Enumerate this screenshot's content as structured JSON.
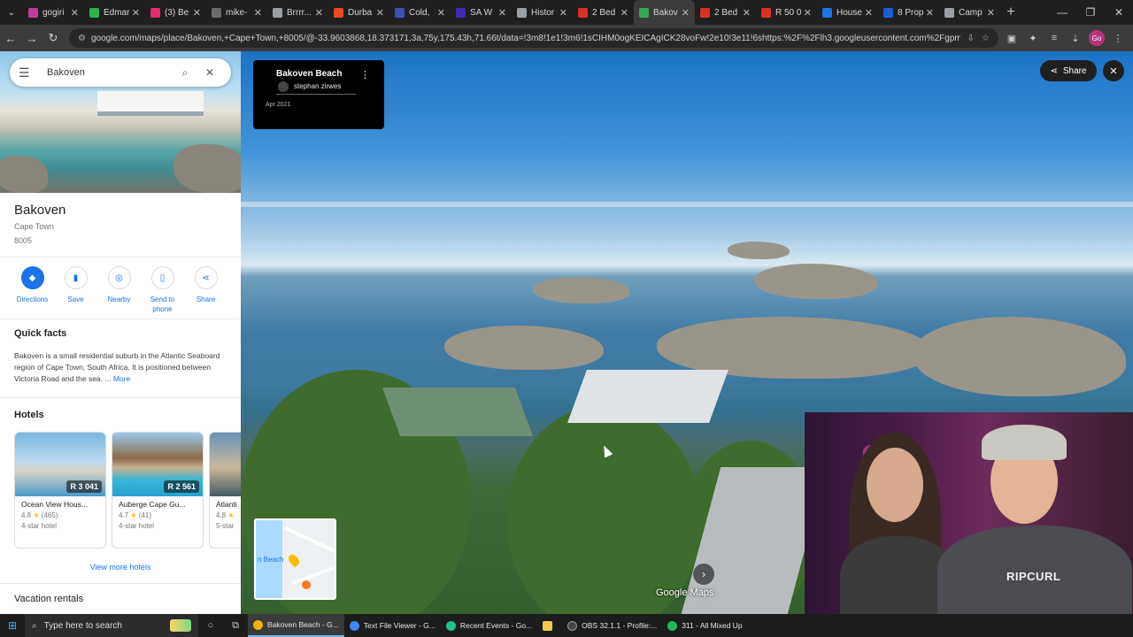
{
  "browser": {
    "tabs": [
      {
        "label": "gogiri",
        "color": "#c23b9b"
      },
      {
        "label": "Edmar",
        "color": "#2bb24c"
      },
      {
        "label": "(3) Be",
        "color": "#e8296d"
      },
      {
        "label": "mike-",
        "color": "#6b6b6b"
      },
      {
        "label": "Brrrr...",
        "color": "#9aa0a6"
      },
      {
        "label": "Durba",
        "color": "#e8491d"
      },
      {
        "label": "Cold,",
        "color": "#3f51b5"
      },
      {
        "label": "SA W",
        "color": "#3f2ab0"
      },
      {
        "label": "Histor",
        "color": "#9aa0a6"
      },
      {
        "label": "2 Bed",
        "color": "#d93025"
      },
      {
        "label": "Bakov",
        "color": "#34a853"
      },
      {
        "label": "2 Bed",
        "color": "#d93025"
      },
      {
        "label": "R 50 0",
        "color": "#d93025"
      },
      {
        "label": "House",
        "color": "#1a73e8"
      },
      {
        "label": "8 Prop",
        "color": "#1a5fd0"
      },
      {
        "label": "Camp",
        "color": "#9aa0a6"
      }
    ],
    "url": "google.com/maps/place/Bakoven,+Cape+Town,+8005/@-33.9603868,18.373171,3a,75y,175.43h,71.66t/data=!3m8!1e1!3m6!1sCIHM0ogKEICAgICK28voFw!2e10!3e11!6shttps:%2F%2Flh3.googleusercontent.com%2Fgpms-cs-s%2FABJJf50J..."
  },
  "maps": {
    "search_value": "Bakoven",
    "place": {
      "title": "Bakoven",
      "city": "Cape Town",
      "postcode": "8005"
    },
    "actions": [
      {
        "label": "Directions",
        "icon": "directions-icon"
      },
      {
        "label": "Save",
        "icon": "bookmark-icon"
      },
      {
        "label": "Nearby",
        "icon": "nearby-icon"
      },
      {
        "label": "Send to phone",
        "icon": "phone-icon"
      },
      {
        "label": "Share",
        "icon": "share-icon"
      }
    ],
    "quick_facts": {
      "heading": "Quick facts",
      "text": "Bakoven is a small residential suburb in the Atlantic Seaboard region of Cape Town, South Africa. It is positioned between Victoria Road and the sea. ...",
      "more": "More"
    },
    "hotels": {
      "heading": "Hotels",
      "items": [
        {
          "name": "Ocean View Hous...",
          "price": "R 3 041",
          "rating": "4.8",
          "reviews": "(465)",
          "type": "4-star hotel"
        },
        {
          "name": "Auberge Cape Gu...",
          "price": "R 2 561",
          "rating": "4.7",
          "reviews": "(41)",
          "type": "4-star hotel"
        },
        {
          "name": "Atlanti",
          "price": "",
          "rating": "4.8",
          "reviews": "",
          "type": "5-star"
        }
      ],
      "view_more": "View more hotels"
    },
    "vacation_heading": "Vacation rentals",
    "photo": {
      "title": "Bakoven Beach",
      "author": "stephan zirwes",
      "date": "Apr 2021",
      "share_label": "Share",
      "minimap_label": "n Beach",
      "watermark": "Google Maps"
    }
  },
  "webcam": {
    "shirt_text": "RIPCURL"
  },
  "taskbar": {
    "search_placeholder": "Type here to search",
    "apps": [
      {
        "label": "Bakoven Beach - G...",
        "color": "#f4b400",
        "active": true
      },
      {
        "label": "Text File Viewer - G...",
        "color": "#4285f4",
        "active": false
      },
      {
        "label": "Recent Events - Go...",
        "color": "#21c28c",
        "active": false
      },
      {
        "label": "",
        "color": "#f2c94c",
        "active": false
      },
      {
        "label": "OBS 32.1.1 - Profile:...",
        "color": "#444444",
        "active": false
      },
      {
        "label": "311 - All Mixed Up",
        "color": "#1db954",
        "active": false
      }
    ]
  }
}
